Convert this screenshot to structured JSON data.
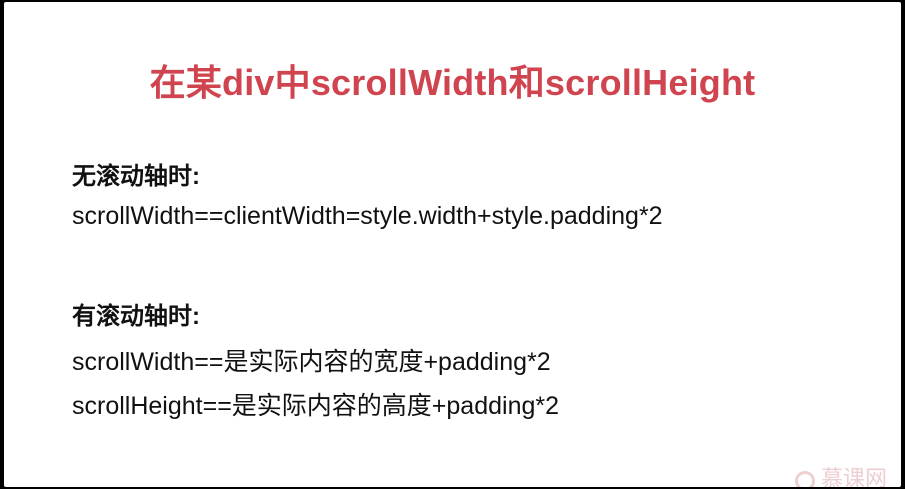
{
  "slide": {
    "title": "在某div中scrollWidth和scrollHeight",
    "no_scrollbar": {
      "heading": "无滚动轴时:",
      "formula": "scrollWidth==clientWidth=style.width+style.padding*2"
    },
    "with_scrollbar": {
      "heading": "有滚动轴时:",
      "formula_width": "scrollWidth==是实际内容的宽度+padding*2",
      "formula_height": "scrollHeight==是实际内容的高度+padding*2"
    },
    "watermark": "慕课网"
  },
  "colors": {
    "title": "#d0444f",
    "body_text": "#111111",
    "background": "#ffffff",
    "frame": "#000000"
  }
}
